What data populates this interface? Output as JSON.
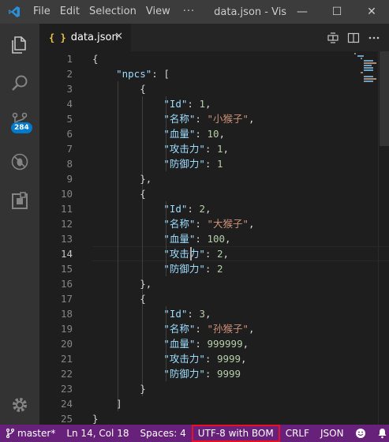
{
  "titlebar": {
    "menu": [
      "File",
      "Edit",
      "Selection",
      "View"
    ],
    "more": "···",
    "title": "data.json - Vis",
    "controls": {
      "minimize": "—",
      "maximize": "☐",
      "close": "✕"
    }
  },
  "activity": {
    "badge": "284",
    "icons": [
      "explorer-icon",
      "search-icon",
      "source-control-icon",
      "debug-icon",
      "extensions-icon",
      "gear-icon"
    ]
  },
  "tab": {
    "icon": "{ }",
    "label": "data.json",
    "close": "✕"
  },
  "editor": {
    "active_line": 14,
    "lines": [
      {
        "n": "1"
      },
      {
        "n": "2"
      },
      {
        "n": "3"
      },
      {
        "n": "4"
      },
      {
        "n": "5"
      },
      {
        "n": "6"
      },
      {
        "n": "7"
      },
      {
        "n": "8"
      },
      {
        "n": "9"
      },
      {
        "n": "10"
      },
      {
        "n": "11"
      },
      {
        "n": "12"
      },
      {
        "n": "13"
      },
      {
        "n": "14"
      },
      {
        "n": "15"
      },
      {
        "n": "16"
      },
      {
        "n": "17"
      },
      {
        "n": "18"
      },
      {
        "n": "19"
      },
      {
        "n": "20"
      },
      {
        "n": "21"
      },
      {
        "n": "22"
      },
      {
        "n": "23"
      },
      {
        "n": "24"
      },
      {
        "n": "25"
      }
    ],
    "code": {
      "l1": "{",
      "l2_key": "\"npcs\"",
      "l2_rest": ": [",
      "l3": "{",
      "l4_key": "\"Id\"",
      "l4_val": "1",
      "l5_key": "\"名称\"",
      "l5_val": "\"小猴子\"",
      "l6_key": "\"血量\"",
      "l6_val": "10",
      "l7_key": "\"攻击力\"",
      "l7_val": "1",
      "l8_key": "\"防御力\"",
      "l8_val": "1",
      "l9": "},",
      "l10": "{",
      "l11_key": "\"Id\"",
      "l11_val": "2",
      "l12_key": "\"名称\"",
      "l12_val": "\"大猴子\"",
      "l13_key": "\"血量\"",
      "l13_val": "100",
      "l14_key": "\"攻击力\"",
      "l14_val": "2",
      "l15_key": "\"防御力\"",
      "l15_val": "2",
      "l16": "},",
      "l17": "{",
      "l18_key": "\"Id\"",
      "l18_val": "3",
      "l19_key": "\"名称\"",
      "l19_val": "\"孙猴子\"",
      "l20_key": "\"血量\"",
      "l20_val": "999999",
      "l21_key": "\"攻击力\"",
      "l21_val": "9999",
      "l22_key": "\"防御力\"",
      "l22_val": "9999",
      "l23": "}",
      "l24": "]",
      "l25": "}"
    }
  },
  "statusbar": {
    "branch": "master*",
    "position": "Ln 14, Col 18",
    "spaces": "Spaces: 4",
    "encoding": "UTF-8 with BOM",
    "eol": "CRLF",
    "language": "JSON"
  },
  "colors": {
    "statusbar": "#68217a",
    "accent": "#007acc",
    "highlight_border": "#e81123"
  }
}
